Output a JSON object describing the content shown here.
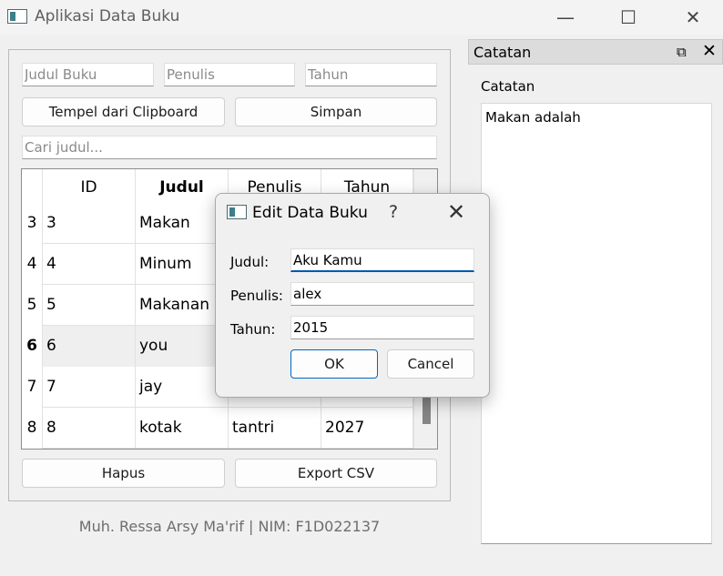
{
  "window": {
    "title": "Aplikasi Data Buku",
    "minimize_glyph": "—",
    "maximize_glyph": "☐",
    "close_glyph": "✕"
  },
  "form": {
    "judul_placeholder": "Judul Buku",
    "penulis_placeholder": "Penulis",
    "tahun_placeholder": "Tahun",
    "paste_label": "Tempel dari Clipboard",
    "save_label": "Simpan",
    "search_placeholder": "Cari judul..."
  },
  "table": {
    "headers": [
      "ID",
      "Judul",
      "Penulis",
      "Tahun"
    ],
    "rows": [
      {
        "row_header": "3",
        "id": "3",
        "judul": "Makan",
        "penulis": "",
        "tahun": ""
      },
      {
        "row_header": "4",
        "id": "4",
        "judul": "Minum",
        "penulis": "",
        "tahun": ""
      },
      {
        "row_header": "5",
        "id": "5",
        "judul": "Makanan",
        "penulis": "",
        "tahun": ""
      },
      {
        "row_header": "6",
        "id": "6",
        "judul": "you",
        "penulis": "",
        "tahun": ""
      },
      {
        "row_header": "7",
        "id": "7",
        "judul": "jay",
        "penulis": "",
        "tahun": ""
      },
      {
        "row_header": "8",
        "id": "8",
        "judul": "kotak",
        "penulis": "tantri",
        "tahun": "2027"
      }
    ],
    "selected_row_index": 3,
    "scroll_position": 0.75
  },
  "actions": {
    "delete_label": "Hapus",
    "export_label": "Export CSV"
  },
  "footer": {
    "text": "Muh. Ressa Arsy Ma'rif | NIM: F1D022137"
  },
  "dock": {
    "title": "Catatan",
    "float_glyph": "⧉",
    "close_glyph": "✕",
    "notes_label": "Catatan",
    "notes_text": "Makan adalah"
  },
  "dialog": {
    "title": "Edit Data Buku",
    "help_glyph": "?",
    "close_glyph": "✕",
    "judul_label": "Judul:",
    "judul_value": "Aku Kamu",
    "penulis_label": "Penulis:",
    "penulis_value": "alex",
    "tahun_label": "Tahun:",
    "tahun_value": "2015",
    "ok_label": "OK",
    "cancel_label": "Cancel"
  },
  "colors": {
    "focus_accent": "#0058b0",
    "window_bg": "#f0f0f0",
    "selected_row_bg": "#efefef"
  }
}
